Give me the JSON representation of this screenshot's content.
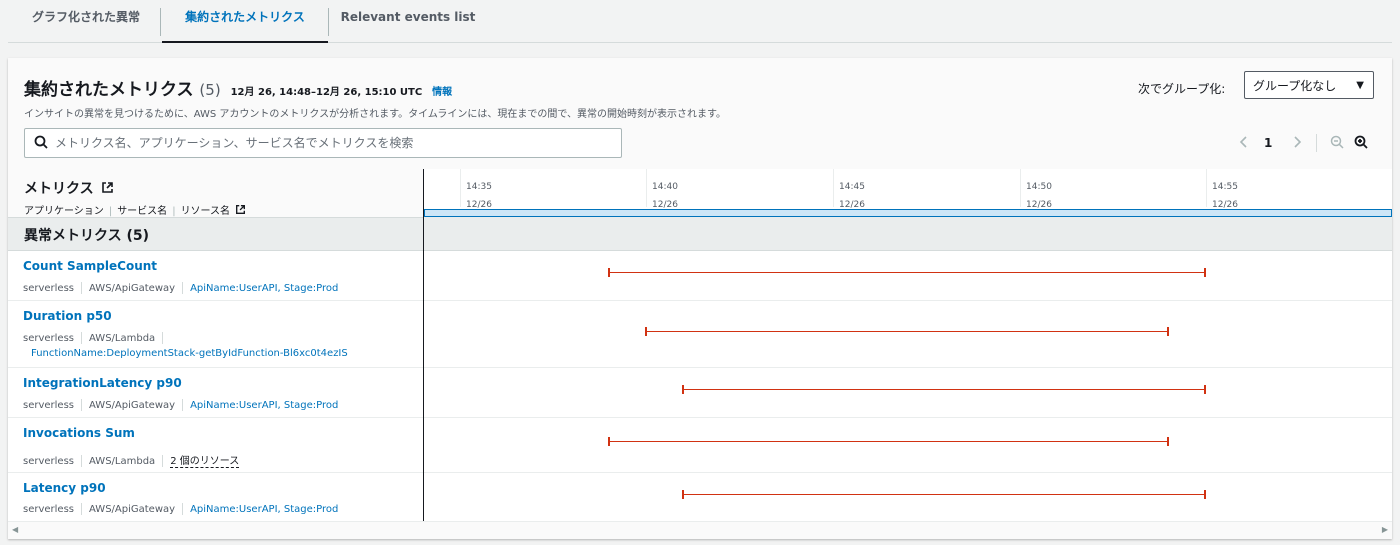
{
  "tabs": [
    {
      "label": "グラフ化された異常",
      "active": false
    },
    {
      "label": "集約されたメトリクス",
      "active": true
    },
    {
      "label": "Relevant events list",
      "active": false
    }
  ],
  "panel": {
    "title": "集約されたメトリクス",
    "count": "(5)",
    "time_range": "12月 26, 14:48–12月 26, 15:10 UTC",
    "info_link": "情報",
    "description": "インサイトの異常を見つけるために、AWS アカウントのメトリクスが分析されます。タイムラインには、現在までの間で、異常の開始時刻が表示されます。",
    "search_placeholder": "メトリクス名、アプリケーション、サービス名でメトリクスを検索",
    "group_by_label": "次でグループ化:",
    "group_by_value": "グループ化なし",
    "page_number": "1"
  },
  "columns": {
    "metrics_header": "メトリクス",
    "sub_application": "アプリケーション",
    "sub_service": "サービス名",
    "sub_resource": "リソース名"
  },
  "timeline": {
    "ticks": [
      {
        "time": "14:35",
        "date": "12/26"
      },
      {
        "time": "14:40",
        "date": "12/26"
      },
      {
        "time": "14:45",
        "date": "12/26"
      },
      {
        "time": "14:50",
        "date": "12/26"
      },
      {
        "time": "14:55",
        "date": "12/26"
      }
    ],
    "bar_color": "#d13212"
  },
  "group": {
    "label": "異常メトリクス (5)"
  },
  "rows": [
    {
      "name": "Count SampleCount",
      "application": "serverless",
      "service": "AWS/ApiGateway",
      "resource": "ApiName:UserAPI, Stage:Prod",
      "start": "14:40",
      "end": "14:56"
    },
    {
      "name": "Duration p50",
      "application": "serverless",
      "service": "AWS/Lambda",
      "resource": "FunctionName:DeploymentStack-getByIdFunction-Bl6xc0t4ezIS",
      "start": "14:41",
      "end": "14:55"
    },
    {
      "name": "IntegrationLatency p90",
      "application": "serverless",
      "service": "AWS/ApiGateway",
      "resource": "ApiName:UserAPI, Stage:Prod",
      "start": "14:42",
      "end": "14:56"
    },
    {
      "name": "Invocations Sum",
      "application": "serverless",
      "service": "AWS/Lambda",
      "resource": "2 個のリソース",
      "start": "14:40",
      "end": "14:55"
    },
    {
      "name": "Latency p90",
      "application": "serverless",
      "service": "AWS/ApiGateway",
      "resource": "ApiName:UserAPI, Stage:Prod",
      "start": "14:42",
      "end": "14:56"
    }
  ]
}
